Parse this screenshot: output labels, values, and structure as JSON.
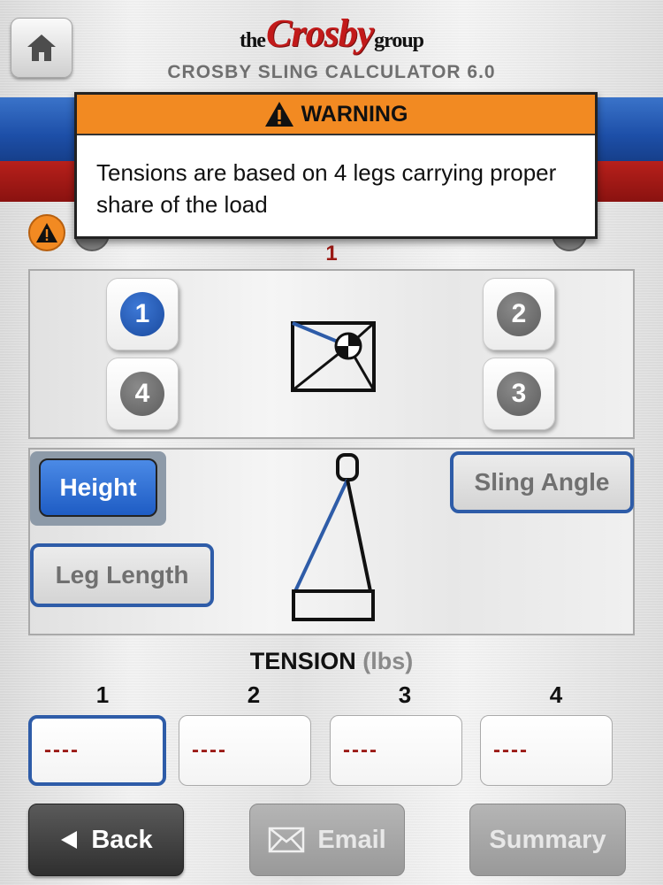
{
  "header": {
    "logo_the": "the",
    "logo_brand": "Crosby",
    "logo_group": "group",
    "app_title": "CROSBY SLING CALCULATOR 6.0"
  },
  "warning": {
    "title": "WARNING",
    "message": "Tensions are based on 4 legs carrying proper share of the load"
  },
  "selected_leg_indicator": "1",
  "legs": [
    {
      "number": "1",
      "selected": true
    },
    {
      "number": "2",
      "selected": false
    },
    {
      "number": "3",
      "selected": false
    },
    {
      "number": "4",
      "selected": false
    }
  ],
  "mode_buttons": {
    "height": "Height",
    "sling_angle": "Sling Angle",
    "leg_length": "Leg Length",
    "active": "Height"
  },
  "tension": {
    "title": "TENSION",
    "unit": "(lbs)",
    "labels": [
      "1",
      "2",
      "3",
      "4"
    ],
    "values": [
      "----",
      "----",
      "----",
      "----"
    ]
  },
  "footer": {
    "back": "Back",
    "email": "Email",
    "summary": "Summary"
  },
  "colors": {
    "accent_blue": "#1e5cc4",
    "brand_red": "#c21a1a",
    "warning_orange": "#f28a22",
    "value_red": "#9b1a15"
  },
  "icons": [
    "home-icon",
    "warning-triangle-icon",
    "back-arrow-icon",
    "envelope-icon"
  ]
}
